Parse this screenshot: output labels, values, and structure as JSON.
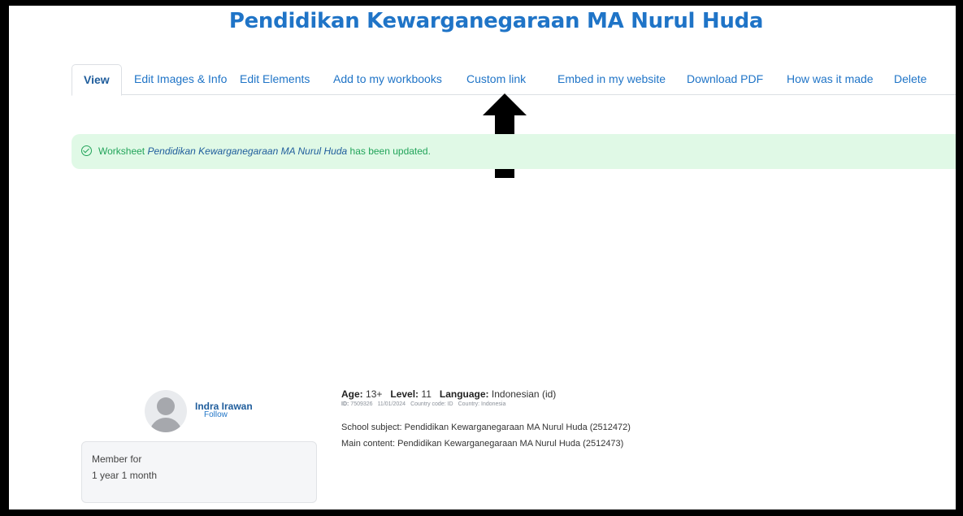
{
  "page": {
    "title": "Pendidikan Kewarganegaraan MA Nurul Huda"
  },
  "tabs": [
    {
      "label": "View",
      "active": true
    },
    {
      "label": "Edit Images & Info"
    },
    {
      "label": "Edit Elements"
    },
    {
      "label": "Add to my workbooks"
    },
    {
      "label": "Custom link"
    },
    {
      "label": "Embed in my website"
    },
    {
      "label": "Download PDF"
    },
    {
      "label": "How was it made"
    },
    {
      "label": "Delete"
    }
  ],
  "alert": {
    "prefix": "Worksheet ",
    "worksheet_name": "Pendidikan Kewarganegaraan MA Nurul Huda",
    "suffix": " has been updated.",
    "icon": "check-circle-icon",
    "color": "#22a45a"
  },
  "annotation": {
    "icon": "up-arrow-icon"
  },
  "author": {
    "name": "Indra Irawan",
    "follow_label": "Follow",
    "member_label": "Member for",
    "member_duration": "1 year 1 month"
  },
  "meta": {
    "age_label": "Age:",
    "age": "13+",
    "level_label": "Level:",
    "level": "11",
    "language_label": "Language:",
    "language": "Indonesian (id)",
    "id_label": "ID:",
    "id": "7509326",
    "date": "11/01/2024",
    "country_code": "Country code: ID",
    "country": "Country: Indonesia",
    "school_subject": "School subject: Pendidikan Kewarganegaraan MA Nurul Huda (2512472)",
    "main_content": "Main content: Pendidikan Kewarganegaraan MA Nurul Huda (2512473)"
  },
  "colors": {
    "accent": "#1f74c7",
    "success_bg": "#e0f9e6"
  }
}
